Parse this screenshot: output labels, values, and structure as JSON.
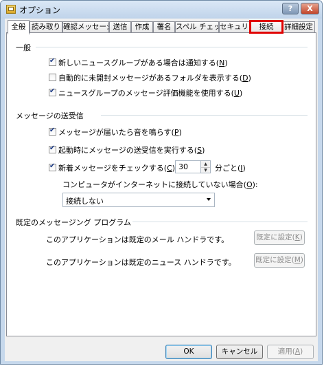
{
  "window": {
    "title": "オプション",
    "help_label": "?",
    "close_label": "X"
  },
  "tabs": [
    {
      "label": "全般"
    },
    {
      "label": "読み取り"
    },
    {
      "label": "確認メッセージ"
    },
    {
      "label": "送信"
    },
    {
      "label": "作成"
    },
    {
      "label": "署名"
    },
    {
      "label": "スペル チェック"
    },
    {
      "label": "セキュリティ"
    },
    {
      "label": "接続"
    },
    {
      "label": "詳細設定"
    }
  ],
  "general": {
    "title": "一般",
    "options": [
      {
        "label": "新しいニュースグループがある場合は通知する(",
        "key": "N",
        "label_end": ")",
        "checked": true
      },
      {
        "label": "自動的に未開封メッセージがあるフォルダを表示する(",
        "key": "D",
        "label_end": ")",
        "checked": false
      },
      {
        "label": "ニュースグループのメッセージ評価機能を使用する(",
        "key": "U",
        "label_end": ")",
        "checked": true
      }
    ]
  },
  "send_receive": {
    "title": "メッセージの送受信",
    "options": [
      {
        "label": "メッセージが届いたら音を鳴らす(",
        "key": "P",
        "label_end": ")",
        "checked": true
      },
      {
        "label": "起動時にメッセージの送受信を実行する(",
        "key": "S",
        "label_end": ")",
        "checked": true
      },
      {
        "label": "新着メッセージをチェックする(",
        "key": "C",
        "label_end": ")",
        "checked": true
      }
    ],
    "interval_value": "30",
    "interval_suffix": "分ごと(",
    "interval_key": "I",
    "interval_suffix_end": ")",
    "offline_label": "コンピュータがインターネットに接続していない場合(",
    "offline_key": "O",
    "offline_label_end": "):",
    "offline_selected": "接続しない"
  },
  "default_programs": {
    "title": "既定のメッセージング プログラム",
    "mail_text": "このアプリケーションは既定のメール ハンドラです。",
    "mail_button": "既定に設定(",
    "mail_key": "K",
    "news_text": "このアプリケーションは既定のニュース ハンドラです。",
    "news_button": "既定に設定(",
    "news_key": "M",
    "button_end": ")"
  },
  "footer": {
    "ok_label": "OK",
    "cancel_label": "キャンセル",
    "apply_label": "適用(",
    "apply_key": "A",
    "apply_end": ")"
  },
  "colors": {
    "highlight": "#e00000",
    "check": "#1c3b86"
  }
}
